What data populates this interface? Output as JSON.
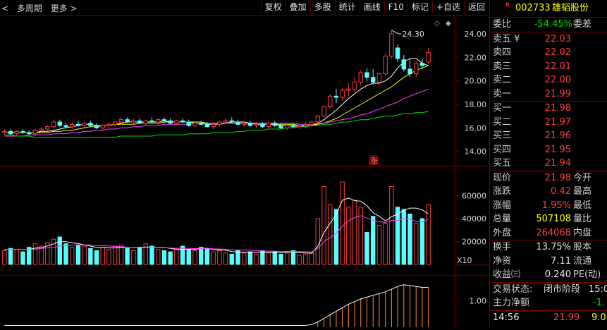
{
  "toolbar": {
    "back_label": "<",
    "period_label": "多周期",
    "more_label": "更多 >",
    "buttons": [
      "复权",
      "叠加",
      "多股",
      "统计",
      "画线",
      "F10",
      "标记",
      "+自选",
      "返回"
    ]
  },
  "main_chart": {
    "price_ticks": [
      "24.00",
      "22.00",
      "20.00",
      "18.00",
      "16.00",
      "14.00"
    ],
    "high_annotation": "24.30",
    "limit_badge": "涨",
    "volume_ticks": [
      "60000",
      "40000",
      "20000"
    ],
    "volume_unit": "X10",
    "indicator_tick": "1.00"
  },
  "colors": {
    "up": "#ff3c3c",
    "down": "#54ffff",
    "ma5": "#ffffff",
    "ma10": "#ffff00",
    "ma20": "#ff40ff",
    "ma60": "#00e000",
    "border": "#7a0000"
  },
  "stock": {
    "prefix": "R",
    "code": "002733",
    "name": "雄韬股份"
  },
  "order_book": {
    "ratio_label": "委比",
    "ratio_value": "-54.45%",
    "diff_label": "委差",
    "sells": [
      {
        "label": "卖五 ¥",
        "price": "22.03"
      },
      {
        "label": "卖四",
        "price": "22.02"
      },
      {
        "label": "卖三",
        "price": "22.01"
      },
      {
        "label": "卖二",
        "price": "22.00"
      },
      {
        "label": "卖一",
        "price": "21.99"
      }
    ],
    "buys": [
      {
        "label": "买一",
        "price": "21.98"
      },
      {
        "label": "买二",
        "price": "21.97"
      },
      {
        "label": "买三",
        "price": "21.96"
      },
      {
        "label": "买四",
        "price": "21.95"
      },
      {
        "label": "买五",
        "price": "21.94"
      }
    ]
  },
  "quote": {
    "price_label": "现价",
    "price": "21.98",
    "open_label": "今开",
    "change_label": "涨跌",
    "change": "0.42",
    "high_label": "最高",
    "pct_label": "涨幅",
    "pct": "1.95%",
    "low_label": "最低",
    "volume_label": "总量",
    "volume": "507108",
    "vol_ratio_label": "量比",
    "outer_label": "外盘",
    "outer": "264068",
    "inner_label": "内盘",
    "turnover_label": "换手",
    "turnover": "13.75%",
    "share_label": "股本",
    "nav_label": "净资",
    "nav": "7.11",
    "float_label": "流通",
    "eps_label": "收益㈢",
    "eps": "0.240",
    "pe_label": "PE(动)"
  },
  "status": {
    "state_label": "交易状态:",
    "state_value": "闭市阶段",
    "state_time": "15:0",
    "flow_label": "主力净额",
    "flow_value": "-1.",
    "tick_time": "14:56",
    "tick_price": "21.99",
    "tick_vol": "9.0"
  },
  "chart_data": {
    "type": "candlestick",
    "price_axis_ylim": [
      13.2,
      25.2
    ],
    "candles": [
      {
        "o": 15.6,
        "h": 15.9,
        "l": 15.4,
        "c": 15.7
      },
      {
        "o": 15.7,
        "h": 15.9,
        "l": 15.4,
        "c": 15.5
      },
      {
        "o": 15.5,
        "h": 15.8,
        "l": 15.3,
        "c": 15.7
      },
      {
        "o": 15.7,
        "h": 15.9,
        "l": 15.5,
        "c": 15.6
      },
      {
        "o": 15.6,
        "h": 15.8,
        "l": 15.4,
        "c": 15.5
      },
      {
        "o": 15.5,
        "h": 15.9,
        "l": 15.3,
        "c": 15.8
      },
      {
        "o": 15.8,
        "h": 16.1,
        "l": 15.6,
        "c": 15.9
      },
      {
        "o": 15.9,
        "h": 16.2,
        "l": 15.7,
        "c": 16.1
      },
      {
        "o": 16.1,
        "h": 16.7,
        "l": 15.9,
        "c": 16.5
      },
      {
        "o": 16.5,
        "h": 16.7,
        "l": 16.1,
        "c": 16.2
      },
      {
        "o": 16.2,
        "h": 16.4,
        "l": 16.0,
        "c": 16.1
      },
      {
        "o": 16.1,
        "h": 16.5,
        "l": 15.9,
        "c": 16.3
      },
      {
        "o": 16.3,
        "h": 16.6,
        "l": 16.1,
        "c": 16.2
      },
      {
        "o": 16.2,
        "h": 16.5,
        "l": 16.0,
        "c": 16.4
      },
      {
        "o": 16.4,
        "h": 16.6,
        "l": 16.1,
        "c": 16.2
      },
      {
        "o": 16.2,
        "h": 16.4,
        "l": 15.9,
        "c": 16.0
      },
      {
        "o": 16.0,
        "h": 16.3,
        "l": 15.8,
        "c": 16.2
      },
      {
        "o": 16.2,
        "h": 16.5,
        "l": 16.0,
        "c": 16.3
      },
      {
        "o": 16.3,
        "h": 16.6,
        "l": 16.1,
        "c": 16.5
      },
      {
        "o": 16.5,
        "h": 16.9,
        "l": 16.3,
        "c": 16.7
      },
      {
        "o": 16.7,
        "h": 16.9,
        "l": 16.4,
        "c": 16.5
      },
      {
        "o": 16.5,
        "h": 16.8,
        "l": 16.3,
        "c": 16.6
      },
      {
        "o": 16.6,
        "h": 16.8,
        "l": 16.3,
        "c": 16.4
      },
      {
        "o": 16.4,
        "h": 16.7,
        "l": 16.2,
        "c": 16.6
      },
      {
        "o": 16.6,
        "h": 16.9,
        "l": 16.4,
        "c": 16.5
      },
      {
        "o": 16.5,
        "h": 16.8,
        "l": 16.3,
        "c": 16.7
      },
      {
        "o": 16.7,
        "h": 16.9,
        "l": 16.4,
        "c": 16.6
      },
      {
        "o": 16.6,
        "h": 16.8,
        "l": 16.3,
        "c": 16.4
      },
      {
        "o": 16.4,
        "h": 16.7,
        "l": 16.2,
        "c": 16.6
      },
      {
        "o": 16.6,
        "h": 16.8,
        "l": 16.4,
        "c": 16.5
      },
      {
        "o": 16.5,
        "h": 16.7,
        "l": 16.1,
        "c": 16.2
      },
      {
        "o": 16.2,
        "h": 16.5,
        "l": 16.0,
        "c": 16.4
      },
      {
        "o": 16.4,
        "h": 16.6,
        "l": 16.2,
        "c": 16.3
      },
      {
        "o": 16.3,
        "h": 16.5,
        "l": 16.0,
        "c": 16.1
      },
      {
        "o": 16.1,
        "h": 16.4,
        "l": 15.9,
        "c": 16.3
      },
      {
        "o": 16.3,
        "h": 16.6,
        "l": 16.1,
        "c": 16.5
      },
      {
        "o": 16.5,
        "h": 16.8,
        "l": 16.3,
        "c": 16.6
      },
      {
        "o": 16.6,
        "h": 16.9,
        "l": 16.4,
        "c": 16.5
      },
      {
        "o": 16.5,
        "h": 16.7,
        "l": 16.2,
        "c": 16.3
      },
      {
        "o": 16.3,
        "h": 16.6,
        "l": 16.1,
        "c": 16.4
      },
      {
        "o": 16.4,
        "h": 16.6,
        "l": 16.1,
        "c": 16.2
      },
      {
        "o": 16.2,
        "h": 16.5,
        "l": 16.0,
        "c": 16.3
      },
      {
        "o": 16.3,
        "h": 16.5,
        "l": 16.0,
        "c": 16.1
      },
      {
        "o": 16.1,
        "h": 16.6,
        "l": 15.9,
        "c": 16.4
      },
      {
        "o": 16.4,
        "h": 16.6,
        "l": 16.1,
        "c": 16.2
      },
      {
        "o": 16.2,
        "h": 16.4,
        "l": 15.9,
        "c": 16.0
      },
      {
        "o": 16.0,
        "h": 16.3,
        "l": 15.8,
        "c": 16.2
      },
      {
        "o": 16.2,
        "h": 16.4,
        "l": 16.0,
        "c": 16.1
      },
      {
        "o": 16.1,
        "h": 16.3,
        "l": 15.9,
        "c": 16.2
      },
      {
        "o": 16.2,
        "h": 16.5,
        "l": 16.0,
        "c": 16.3
      },
      {
        "o": 16.3,
        "h": 16.6,
        "l": 16.1,
        "c": 16.5
      },
      {
        "o": 16.5,
        "h": 17.1,
        "l": 16.4,
        "c": 17.0
      },
      {
        "o": 17.0,
        "h": 17.9,
        "l": 16.9,
        "c": 17.8
      },
      {
        "o": 17.8,
        "h": 18.9,
        "l": 17.6,
        "c": 18.7
      },
      {
        "o": 18.7,
        "h": 19.3,
        "l": 18.1,
        "c": 18.6
      },
      {
        "o": 18.6,
        "h": 19.4,
        "l": 18.3,
        "c": 19.2
      },
      {
        "o": 19.2,
        "h": 19.8,
        "l": 18.7,
        "c": 19.3
      },
      {
        "o": 19.3,
        "h": 20.3,
        "l": 19.0,
        "c": 19.9
      },
      {
        "o": 19.9,
        "h": 20.9,
        "l": 19.6,
        "c": 20.7
      },
      {
        "o": 20.7,
        "h": 21.1,
        "l": 20.0,
        "c": 20.3
      },
      {
        "o": 20.3,
        "h": 21.0,
        "l": 19.7,
        "c": 19.9
      },
      {
        "o": 19.9,
        "h": 20.7,
        "l": 19.6,
        "c": 20.6
      },
      {
        "o": 20.6,
        "h": 22.3,
        "l": 20.4,
        "c": 22.1
      },
      {
        "o": 22.1,
        "h": 24.3,
        "l": 21.9,
        "c": 24.0
      },
      {
        "o": 22.8,
        "h": 23.1,
        "l": 21.6,
        "c": 21.9
      },
      {
        "o": 21.8,
        "h": 22.2,
        "l": 20.8,
        "c": 21.0
      },
      {
        "o": 21.0,
        "h": 21.9,
        "l": 20.3,
        "c": 20.6
      },
      {
        "o": 20.6,
        "h": 21.7,
        "l": 20.3,
        "c": 21.5
      },
      {
        "o": 21.5,
        "h": 21.9,
        "l": 21.0,
        "c": 21.3
      },
      {
        "o": 21.6,
        "h": 22.8,
        "l": 21.4,
        "c": 22.4
      }
    ],
    "ma": [
      {
        "name": "MA5",
        "values": [
          15.6,
          15.6,
          15.6,
          15.6,
          15.6,
          15.6,
          15.7,
          15.7,
          15.8,
          15.9,
          16.0,
          16.1,
          16.2,
          16.3,
          16.3,
          16.2,
          16.2,
          16.2,
          16.3,
          16.4,
          16.5,
          16.5,
          16.5,
          16.5,
          16.5,
          16.5,
          16.6,
          16.5,
          16.5,
          16.5,
          16.5,
          16.4,
          16.4,
          16.3,
          16.3,
          16.3,
          16.4,
          16.5,
          16.5,
          16.5,
          16.4,
          16.3,
          16.3,
          16.3,
          16.3,
          16.2,
          16.2,
          16.2,
          16.1,
          16.2,
          16.2,
          16.4,
          16.7,
          17.1,
          17.5,
          18.0,
          18.5,
          18.9,
          19.3,
          19.6,
          19.8,
          19.8,
          20.0,
          20.4,
          21.1,
          21.6,
          21.9,
          21.9,
          21.5,
          21.3
        ]
      },
      {
        "name": "MA10",
        "values": [
          15.6,
          15.6,
          15.6,
          15.6,
          15.6,
          15.6,
          15.6,
          15.6,
          15.7,
          15.7,
          15.8,
          15.8,
          15.9,
          16.0,
          16.1,
          16.1,
          16.2,
          16.2,
          16.3,
          16.3,
          16.3,
          16.3,
          16.4,
          16.4,
          16.4,
          16.4,
          16.5,
          16.5,
          16.5,
          16.5,
          16.5,
          16.5,
          16.5,
          16.4,
          16.4,
          16.4,
          16.4,
          16.4,
          16.4,
          16.4,
          16.4,
          16.4,
          16.4,
          16.4,
          16.3,
          16.3,
          16.3,
          16.3,
          16.2,
          16.2,
          16.2,
          16.3,
          16.4,
          16.6,
          16.8,
          17.1,
          17.4,
          17.7,
          18.0,
          18.3,
          18.6,
          18.9,
          19.2,
          19.5,
          19.9,
          20.3,
          20.6,
          20.9,
          21.1,
          21.3
        ]
      },
      {
        "name": "MA20",
        "values": [
          15.3,
          15.3,
          15.3,
          15.3,
          15.4,
          15.4,
          15.4,
          15.4,
          15.5,
          15.5,
          15.5,
          15.6,
          15.6,
          15.7,
          15.7,
          15.8,
          15.8,
          15.9,
          15.9,
          16.0,
          16.0,
          16.1,
          16.1,
          16.2,
          16.2,
          16.2,
          16.3,
          16.3,
          16.3,
          16.3,
          16.3,
          16.4,
          16.4,
          16.4,
          16.4,
          16.4,
          16.4,
          16.4,
          16.4,
          16.4,
          16.4,
          16.4,
          16.4,
          16.4,
          16.4,
          16.4,
          16.4,
          16.4,
          16.3,
          16.3,
          16.3,
          16.4,
          16.4,
          16.5,
          16.6,
          16.7,
          16.8,
          16.9,
          17.1,
          17.2,
          17.4,
          17.6,
          17.8,
          18.0,
          18.2,
          18.5,
          18.7,
          18.9,
          19.1,
          19.3
        ]
      },
      {
        "name": "MA60",
        "values": [
          15.4,
          15.4,
          15.3,
          15.3,
          15.3,
          15.2,
          15.2,
          15.2,
          15.2,
          15.2,
          15.2,
          15.2,
          15.2,
          15.2,
          15.2,
          15.2,
          15.2,
          15.2,
          15.2,
          15.3,
          15.3,
          15.3,
          15.3,
          15.3,
          15.3,
          15.4,
          15.4,
          15.4,
          15.4,
          15.4,
          15.5,
          15.5,
          15.5,
          15.5,
          15.6,
          15.6,
          15.6,
          15.6,
          15.7,
          15.7,
          15.8,
          15.8,
          15.8,
          15.9,
          15.9,
          15.9,
          16.0,
          16.0,
          16.1,
          16.1,
          16.2,
          16.2,
          16.3,
          16.3,
          16.4,
          16.5,
          16.5,
          16.6,
          16.7,
          16.7,
          16.8,
          16.9,
          17.0,
          17.0,
          17.1,
          17.2,
          17.2,
          17.3,
          17.3,
          17.4
        ]
      }
    ],
    "volume_ylim": [
      0,
      80000
    ],
    "volumes": [
      12000,
      14000,
      13000,
      11000,
      15000,
      18000,
      16000,
      19000,
      22000,
      24000,
      18000,
      15000,
      17000,
      16000,
      14000,
      12000,
      15000,
      13000,
      16000,
      17000,
      14000,
      12000,
      15000,
      18000,
      16000,
      13000,
      12000,
      11000,
      14000,
      16000,
      13000,
      12000,
      15000,
      14000,
      11000,
      12000,
      10000,
      9000,
      12000,
      10000,
      11000,
      9000,
      12000,
      10000,
      11000,
      9000,
      10000,
      12000,
      8000,
      9000,
      10000,
      40000,
      68000,
      52000,
      48000,
      72000,
      50000,
      56000,
      50000,
      28000,
      42000,
      34000,
      36000,
      68000,
      50000,
      48000,
      44000,
      36000,
      40000,
      52000
    ],
    "volume_ma": [
      {
        "name": "VMA5",
        "values": [
          13000,
          13000,
          13000,
          13000,
          13000,
          14200,
          14600,
          16200,
          18000,
          19800,
          19800,
          18800,
          18200,
          17000,
          16000,
          14800,
          14800,
          14400,
          14400,
          14600,
          15000,
          14600,
          14800,
          15200,
          15000,
          14800,
          14800,
          14000,
          13200,
          13200,
          13200,
          13200,
          14000,
          14000,
          13000,
          12800,
          12400,
          11200,
          10800,
          10600,
          10800,
          10400,
          10800,
          10400,
          10600,
          10200,
          10800,
          10800,
          10200,
          10000,
          9800,
          15800,
          27800,
          35800,
          43600,
          56000,
          58000,
          55600,
          55200,
          51200,
          45200,
          42000,
          38000,
          41600,
          44000,
          47200,
          49200,
          49200,
          47600,
          44000
        ]
      },
      {
        "name": "VMA10",
        "values": [
          13000,
          13000,
          13000,
          13000,
          13000,
          13200,
          14000,
          14400,
          15000,
          16000,
          16500,
          16700,
          17000,
          17000,
          16900,
          16400,
          16300,
          16100,
          15700,
          15500,
          15000,
          14600,
          14600,
          14800,
          14800,
          14700,
          14600,
          14300,
          14100,
          14100,
          14000,
          13900,
          14100,
          14000,
          13600,
          13500,
          13300,
          12900,
          12600,
          12600,
          12400,
          12000,
          11800,
          11500,
          11600,
          11400,
          11300,
          11400,
          11200,
          11100,
          10900,
          13800,
          19700,
          23400,
          27300,
          33400,
          38200,
          41000,
          42500,
          40500,
          38600,
          37400,
          36600,
          38400,
          38400,
          40000,
          39600,
          37500,
          37200,
          39400
        ]
      }
    ],
    "indicator_ylim": [
      0.7,
      1.25
    ],
    "indicator_line": [
      0.72,
      0.72,
      0.72,
      0.72,
      0.72,
      0.72,
      0.72,
      0.72,
      0.72,
      0.72,
      0.72,
      0.72,
      0.72,
      0.72,
      0.72,
      0.72,
      0.72,
      0.72,
      0.72,
      0.72,
      0.72,
      0.72,
      0.72,
      0.72,
      0.72,
      0.72,
      0.72,
      0.72,
      0.72,
      0.72,
      0.72,
      0.72,
      0.72,
      0.72,
      0.72,
      0.72,
      0.72,
      0.72,
      0.72,
      0.72,
      0.72,
      0.72,
      0.72,
      0.72,
      0.72,
      0.72,
      0.72,
      0.72,
      0.72,
      0.72,
      0.73,
      0.76,
      0.8,
      0.84,
      0.88,
      0.92,
      0.96,
      0.99,
      1.02,
      1.04,
      1.06,
      1.08,
      1.1,
      1.13,
      1.16,
      1.18,
      1.17,
      1.16,
      1.15,
      1.15
    ]
  }
}
